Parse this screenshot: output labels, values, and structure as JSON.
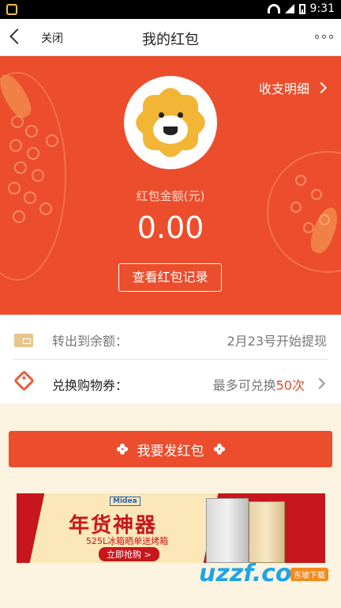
{
  "status_bar": {
    "time": "9:31"
  },
  "nav": {
    "close_label": "关闭",
    "title": "我的红包"
  },
  "hero": {
    "detail_link": "收支明细",
    "amount_label": "红包金额(元)",
    "amount_value": "0.00",
    "record_button": "查看红包记录"
  },
  "list": {
    "transfer": {
      "label": "转出到余额：",
      "value": "2月23号开始提现"
    },
    "exchange": {
      "label": "兑换购物券：",
      "value_prefix": "最多可兑换",
      "value_highlight": "50次"
    }
  },
  "send_button": "我要发红包",
  "banner": {
    "brand": "Midea",
    "headline": "年货神器",
    "subline": "525L冰箱晒单送烤箱",
    "cta": "立即抢购 >"
  },
  "watermark": {
    "text": "uzzf.com",
    "tag": "东坡下载"
  },
  "colors": {
    "primary": "#ec4d2c",
    "highlight": "#e04a2a",
    "background": "#fdf3e1"
  }
}
